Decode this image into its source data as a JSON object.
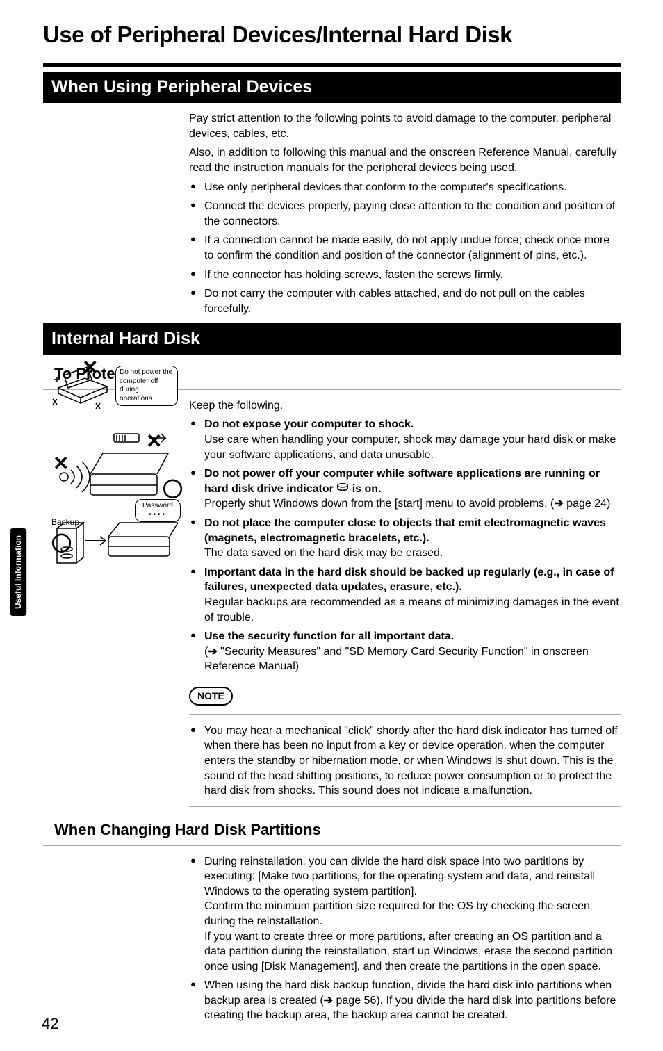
{
  "tab_label": "Useful Information",
  "page_number": "42",
  "title": "Use of Peripheral Devices/Internal Hard Disk",
  "section1": {
    "bar": "When Using Peripheral Devices",
    "intro1": "Pay strict attention to the following points to avoid damage to the computer, peripheral devices, cables, etc.",
    "intro2": "Also, in addition to following this manual and the onscreen Reference Manual, carefully read the instruction manuals for the peripheral devices being used.",
    "items": [
      "Use only peripheral devices that conform to the computer's specifications.",
      "Connect the devices properly, paying close attention to the condition and position of the connectors.",
      "If a connection cannot be made easily, do not apply undue force; check once more to confirm the condition and position of the connector (alignment of pins, etc.).",
      "If the connector has holding screws, fasten the screws firmly.",
      "Do not carry the computer with cables attached, and do not pull on the cables forcefully."
    ]
  },
  "section2": {
    "bar": "Internal Hard Disk",
    "sub": "To Protect Data",
    "keep": "Keep the following.",
    "items": [
      {
        "lead": "Do not expose your computer to shock.",
        "rest": "Use care when handling your computer, shock may damage your hard disk or make your software applications, and data unusable."
      },
      {
        "lead_a": "Do not power off your computer while software applications are running or hard disk drive indicator ",
        "lead_b": " is on.",
        "rest_a": "Properly shut Windows down from the [start] menu to avoid problems. (",
        "rest_ref": " page 24)"
      },
      {
        "lead": "Do not place the computer close to objects that emit electromagnetic waves (magnets, electromagnetic bracelets, etc.).",
        "rest": "The data saved on the hard disk may be erased."
      },
      {
        "lead": "Important data in the hard disk should be backed up regularly (e.g., in case of failures, unexpected data updates, erasure, etc.).",
        "rest": "Regular backups are recommended as a means of minimizing damages in the event of trouble."
      },
      {
        "lead": "Use the security function for all important data.",
        "rest_a": "(",
        "rest_ref": " \"Security Measures\" and \"SD Memory Card Security Function\" in onscreen Reference Manual)"
      }
    ],
    "note_label": "NOTE",
    "note_text": "You may hear a mechanical \"click\" shortly after the hard disk indicator has turned off when there has been no input from a key or device operation, when the computer enters the standby or hibernation mode, or when Windows is shut down. This is the sound of the head shifting positions, to reduce power consumption or to protect the hard disk from shocks. This sound does not indicate a malfunction."
  },
  "section3": {
    "sub": "When Changing Hard Disk Partitions",
    "item1_a": "During reinstallation, you can divide the hard disk space into two partitions by executing: [Make two partitions, for the operating system and data, and reinstall Windows to the operating system partition].",
    "item1_b": "Confirm the minimum partition size required for the OS by checking the screen during the reinstallation.",
    "item1_c": "If you want to create three or more partitions, after creating an OS partition and a data partition during the reinstallation, start up Windows, erase the second partition once using [Disk Management], and then create the partitions in the open space.",
    "item2_a": "When using the hard disk backup function, divide the hard disk into partitions when backup area is created (",
    "item2_ref": " page 56). If you divide the hard disk into partitions before creating the backup area, the backup area cannot be created."
  },
  "illus": {
    "caption_top": "Do not power the computer off during operations.",
    "backup": "Backup",
    "password": "Password"
  }
}
